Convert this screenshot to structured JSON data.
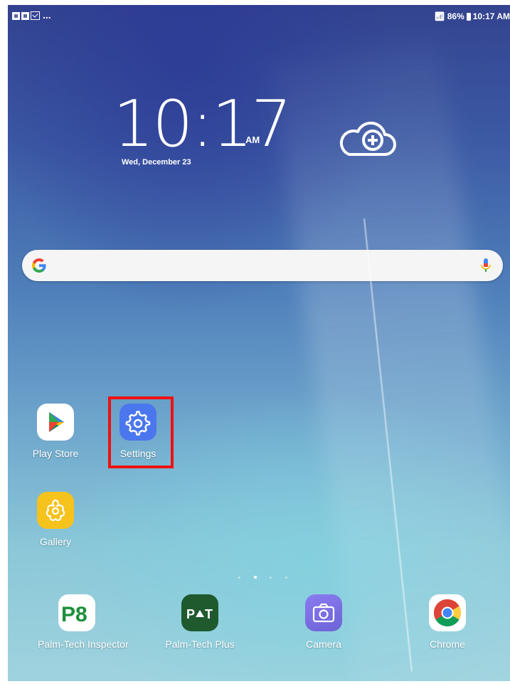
{
  "status_bar": {
    "more_indicator": "...",
    "battery_percent": "86%",
    "time": "10:17 AM"
  },
  "clock": {
    "time": "10:17",
    "ampm": "AM",
    "date": "Wed, December 23"
  },
  "home_apps": [
    {
      "label": "Play Store",
      "icon": "play-store-icon"
    },
    {
      "label": "Settings",
      "icon": "gear-icon"
    },
    {
      "label": "Gallery",
      "icon": "gallery-flower-icon"
    }
  ],
  "dock_apps": [
    {
      "label": "Palm-Tech Inspector",
      "icon": "palm-tech-inspector-logo-icon"
    },
    {
      "label": "Palm-Tech Plus",
      "icon": "palm-tech-plus-logo-icon"
    },
    {
      "label": "Camera",
      "icon": "camera-icon"
    },
    {
      "label": "Chrome",
      "icon": "chrome-icon"
    }
  ],
  "colors": {
    "highlight": "#ee1111",
    "settings_icon_bg": "#4a77ee",
    "gallery_icon_bg": "#f6c21c",
    "palm_tech_plus_bg": "#1f5a2e",
    "camera_icon_bg": "#7b6fe0"
  },
  "page_indicator": {
    "count": 4,
    "active_index": 1
  }
}
